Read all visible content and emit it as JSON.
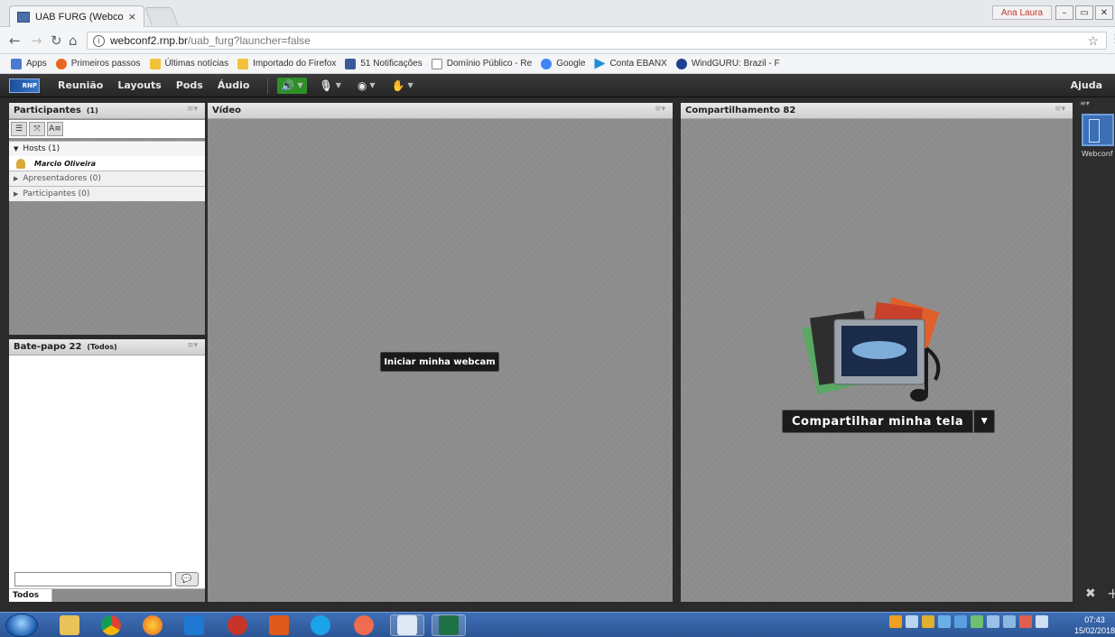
{
  "browser": {
    "tab_title": "UAB FURG (Webconf)",
    "tab_close": "×",
    "profile_name": "Ana Laura",
    "url_domain": "webconf2.rnp.br",
    "url_path": "/uab_furg?launcher=false",
    "bookmarks": [
      {
        "label": "Apps",
        "color": "#4a7bd0"
      },
      {
        "label": "Primeiros passos",
        "color": "#e8661f"
      },
      {
        "label": "Últimas notícias",
        "color": "#f3c13a"
      },
      {
        "label": "Importado do Firefox",
        "color": "#f3c13a"
      },
      {
        "label": "51 Notificações",
        "color": "#3b5998"
      },
      {
        "label": "Domínio Público - Re",
        "color": "#9a9a9a"
      },
      {
        "label": "Google",
        "color": "#4285f4"
      },
      {
        "label": "Conta EBANX",
        "color": "#1f8fd4"
      },
      {
        "label": "WindGURU: Brazil - F",
        "color": "#1f3f8f"
      }
    ]
  },
  "app": {
    "logo": "RNP",
    "menus": [
      "Reunião",
      "Layouts",
      "Pods",
      "Áudio"
    ],
    "help": "Ajuda"
  },
  "participants": {
    "title": "Participantes",
    "count": "(1)",
    "groups": [
      {
        "label": "Hosts (1)",
        "open": true
      },
      {
        "label": "Apresentadores (0)",
        "open": false
      },
      {
        "label": "Participantes (0)",
        "open": false
      }
    ],
    "host_name": "Marcio Oliveira"
  },
  "chat": {
    "title": "Bate-papo 22",
    "scope": "(Todos)",
    "tab": "Todos"
  },
  "video": {
    "title": "Vídeo",
    "start_webcam": "Iniciar minha webcam"
  },
  "share": {
    "title": "Compartilhamento 82",
    "button": "Compartilhar minha tela"
  },
  "right_pod": {
    "label": "Webconf"
  },
  "taskbar": {
    "time": "07:43",
    "date": "15/02/2018"
  }
}
